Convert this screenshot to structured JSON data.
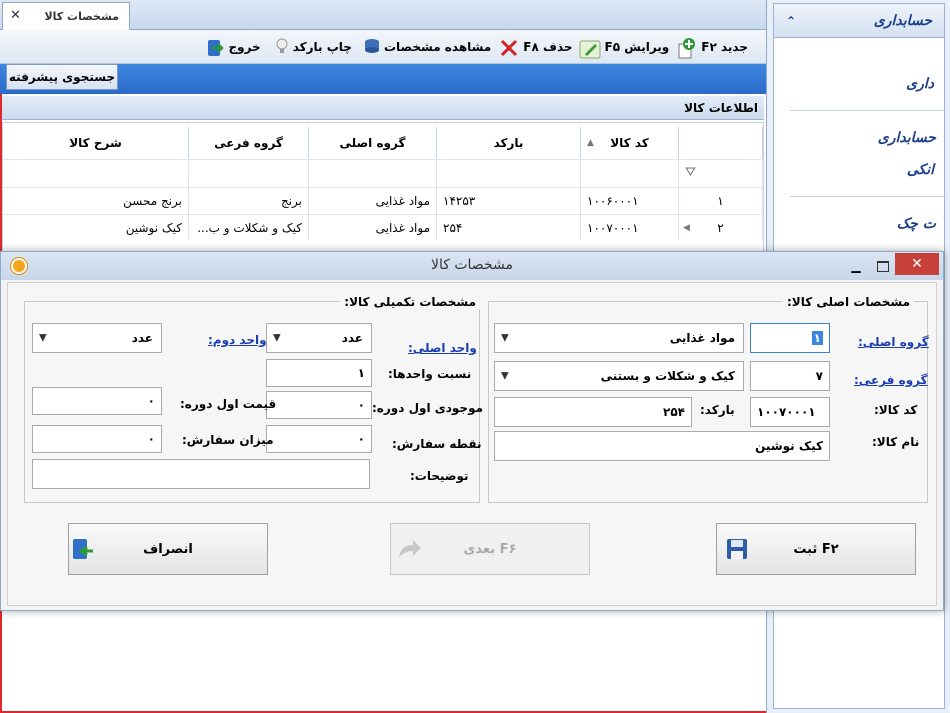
{
  "tab": {
    "title": "مشخصات کالا",
    "close": "✕"
  },
  "toolbar": {
    "new_label": "جدید F۲",
    "edit_label": "ویرایش F۵",
    "delete_label": "حذف F۸",
    "view_label": "مشاهده مشخصات",
    "print_label": "چاپ بارکد",
    "exit_label": "خروج"
  },
  "search": {
    "advanced_label": "جستجوی پیشرفته"
  },
  "panel": {
    "title": "اطلاعات کالا"
  },
  "grid": {
    "columns": [
      "کد کالا",
      "بارکد",
      "گروه اصلی",
      "گروه فرعی",
      "شرح کالا"
    ],
    "rows": [
      {
        "num": "۱",
        "code": "۱۰۰۶۰۰۰۱",
        "barcode": "۱۴۲۵۳",
        "main_group": "مواد غذایی",
        "sub_group": "برنج",
        "desc": "برنج محسن"
      },
      {
        "num": "۲",
        "code": "۱۰۰۷۰۰۰۱",
        "barcode": "۲۵۴",
        "main_group": "مواد غذایی",
        "sub_group": "کیک و شکلات و ب...",
        "desc": "کیک نوشین"
      }
    ]
  },
  "sidebar": {
    "header": "حسابداری",
    "items": [
      "داری",
      "حسابداری",
      "انکی",
      "ت چک"
    ]
  },
  "dialog": {
    "title": "مشخصات کالا",
    "main_group_title": "مشخصات اصلی کالا:",
    "extra_group_title": "مشخصات تکمیلی کالا:",
    "labels": {
      "main_group": "گروه اصلی:",
      "sub_group": "گروه فرعی:",
      "code": "کد کالا:",
      "barcode": "بارکد:",
      "name": "نام کالا:",
      "unit_main": "واحد اصلی:",
      "unit_second": "واحد دوم:",
      "unit_ratio": "نسبت واحدها:",
      "opening_stock": "موجودی اول دوره:",
      "opening_price": "قیمت اول دوره:",
      "reorder_point": "نقطه سفارش:",
      "order_qty": "میزان سفارش:",
      "notes": "توضیحات:"
    },
    "values": {
      "main_group_code": "۱",
      "main_group_name": "مواد غذایی",
      "sub_group_code": "۷",
      "sub_group_name": "کیک و شکلات و بستنی",
      "code": "۱۰۰۷۰۰۰۱",
      "barcode": "۲۵۴",
      "name": "کیک نوشین",
      "unit_main": "عدد",
      "unit_second": "عدد",
      "unit_ratio": "۱",
      "opening_stock": "۰",
      "opening_price": "۰",
      "reorder_point": "۰",
      "order_qty": "۰",
      "notes": ""
    },
    "buttons": {
      "save": "ثبت F۲",
      "next": "بعدی F۶",
      "cancel": "انصراف"
    }
  }
}
